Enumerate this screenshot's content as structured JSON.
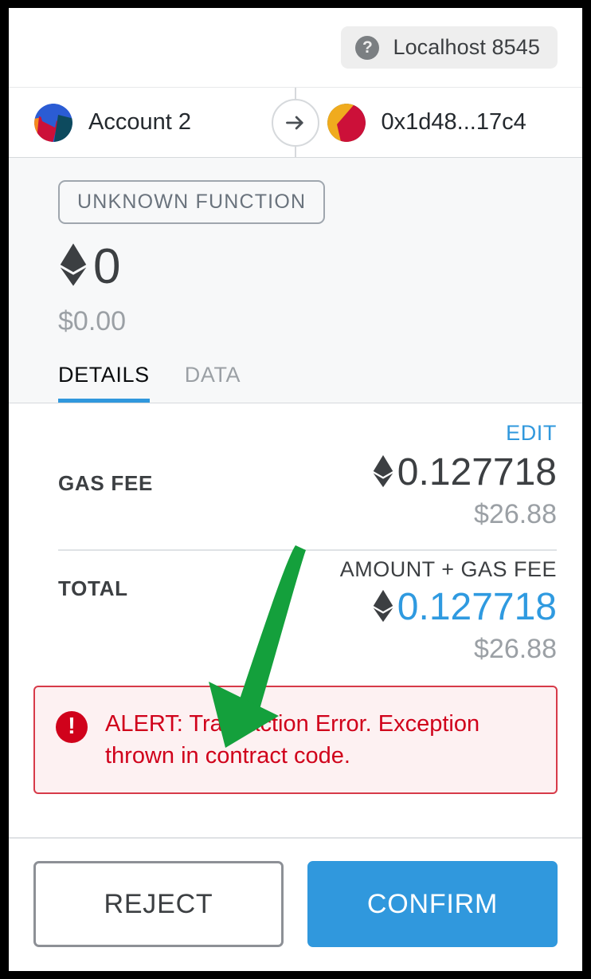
{
  "window": {
    "title": "MetaMask Confirm Transaction"
  },
  "network": {
    "icon": "question-circle-icon",
    "name": "Localhost 8545"
  },
  "accounts": {
    "sender": {
      "name": "Account 2",
      "avatar": "jazzicon-blue-orange-crimson-teal"
    },
    "transfer_icon": "arrow-right-icon",
    "recipient": {
      "name": "0x1d48...17c4",
      "avatar": "jazzicon-teal-gold-crimson"
    }
  },
  "summary": {
    "function_badge": "UNKNOWN FUNCTION",
    "currency_icon": "ethereum-diamond-icon",
    "amount": "0",
    "fiat_amount": "$0.00"
  },
  "tabs": [
    {
      "label": "DETAILS",
      "active": true
    },
    {
      "label": "DATA",
      "active": false
    }
  ],
  "details": {
    "edit_label": "EDIT",
    "rows": [
      {
        "label": "GAS FEE",
        "subheading": "",
        "currency_icon": "ethereum-diamond-icon",
        "value": "0.127718",
        "fiat": "$26.88",
        "accent": false
      },
      {
        "label": "TOTAL",
        "subheading": "AMOUNT + GAS FEE",
        "currency_icon": "ethereum-diamond-icon",
        "value": "0.127718",
        "fiat": "$26.88",
        "accent": true
      }
    ]
  },
  "alert": {
    "icon": "error-exclamation-icon",
    "message": "ALERT: Transaction Error. Exception thrown in contract code."
  },
  "footer": {
    "reject_label": "REJECT",
    "confirm_label": "CONFIRM"
  },
  "annotation": {
    "type": "arrow",
    "color": "#14a03c",
    "points_to": "alert-message"
  },
  "colors": {
    "accent_blue": "#3098dd",
    "error_red": "#d0021b",
    "alert_bg": "#fdf1f2",
    "annotation_green": "#14a03c",
    "summary_bg": "#f7f8f9",
    "text_dark": "#3c3f42",
    "text_muted": "#9ba0a5"
  }
}
